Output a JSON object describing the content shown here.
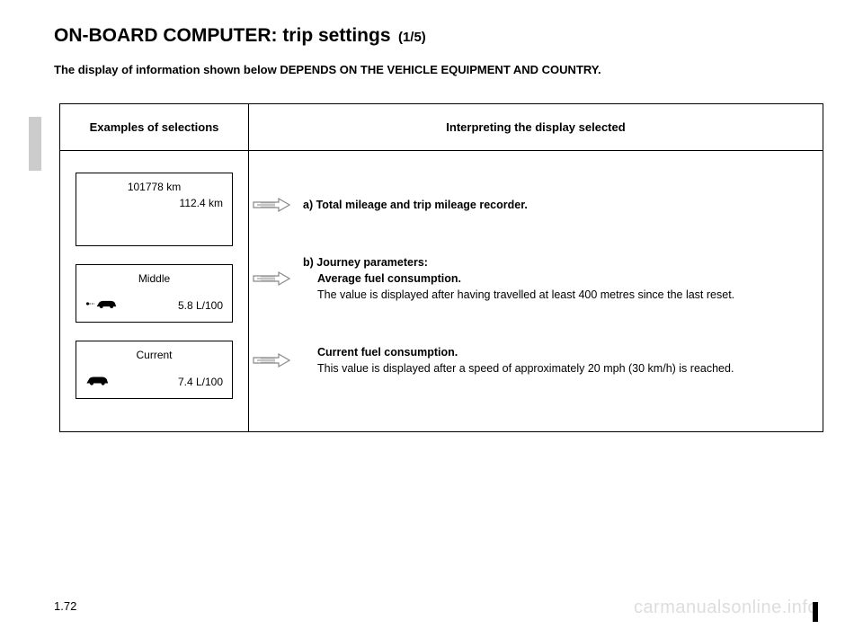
{
  "title": {
    "main": "ON-BOARD COMPUTER: trip settings",
    "part": "(1/5)"
  },
  "notice": "The display of information shown below DEPENDS ON THE VEHICLE EQUIPMENT AND COUNTRY.",
  "table": {
    "header_col1": "Examples of selections",
    "header_col2": "Interpreting the display selected"
  },
  "displays": {
    "a": {
      "line1": "101778 km",
      "line2": "112.4 km"
    },
    "b": {
      "label": "Middle",
      "value": "5.8 L/100"
    },
    "c": {
      "label": "Current",
      "value": "7.4 L/100"
    }
  },
  "descriptions": {
    "a": "a) Total mileage and trip mileage recorder.",
    "b_lead": "b) Journey parameters:",
    "b_bold": "Average fuel consumption.",
    "b_text": "The value is displayed after having travelled at least 400 metres since the last reset.",
    "c_bold": "Current fuel consumption.",
    "c_text": "This value is displayed after a speed of approximately 20 mph (30 km/h) is reached."
  },
  "page_number": "1.72",
  "watermark": "carmanualsonline.info"
}
